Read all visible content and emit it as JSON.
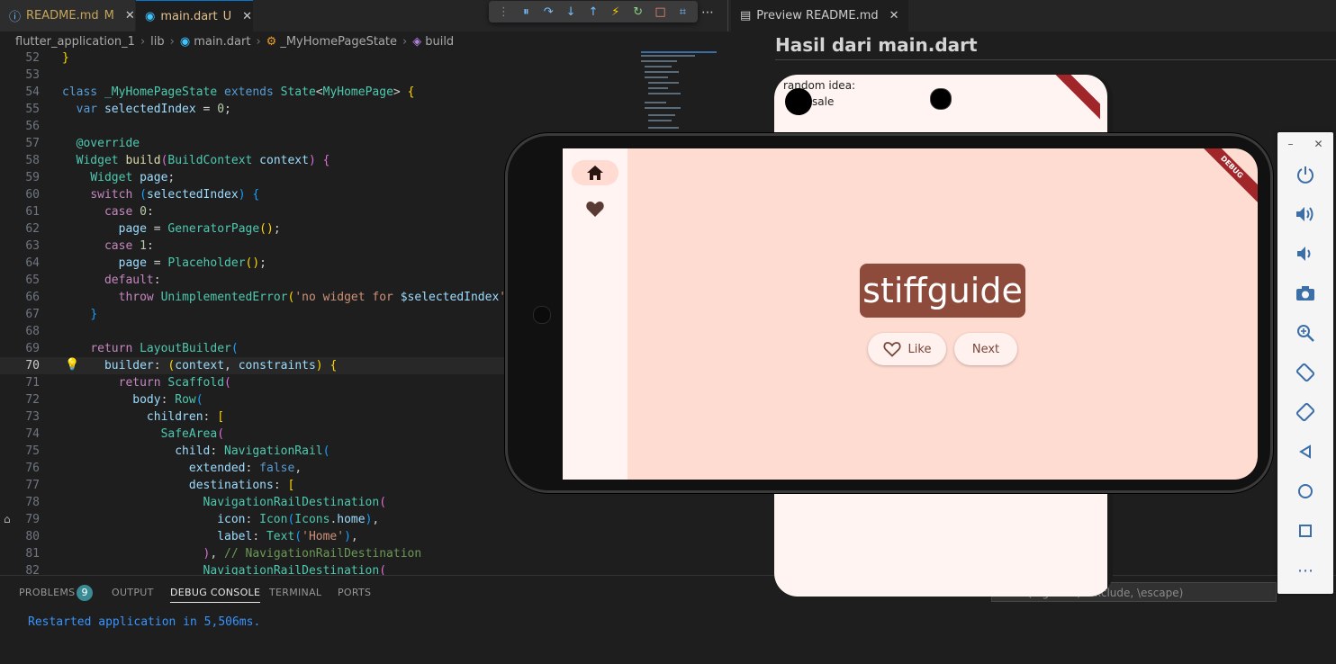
{
  "editor_tabs": [
    {
      "label": "README.md",
      "status": "M",
      "icon": "info-icon"
    },
    {
      "label": "main.dart",
      "status": "U",
      "icon": "dart-icon"
    }
  ],
  "breadcrumb": [
    "flutter_application_1",
    "lib",
    "main.dart",
    "_MyHomePageState",
    "build"
  ],
  "code_lines": [
    {
      "n": "52",
      "html": "<span class='br1'>}</span>"
    },
    {
      "n": "53",
      "html": ""
    },
    {
      "n": "54",
      "html": "<span class='kw'>class</span> <span class='cl'>_MyHomePageState</span> <span class='kw'>extends</span> <span class='cl'>State</span>&lt;<span class='cl'>MyHomePage</span>&gt; <span class='br1'>{</span>"
    },
    {
      "n": "55",
      "html": "  <span class='kw'>var</span> <span class='vr'>selectedIndex</span> = <span class='num'>0</span>;"
    },
    {
      "n": "56",
      "html": ""
    },
    {
      "n": "57",
      "html": "  <span class='cl'>@override</span>"
    },
    {
      "n": "58",
      "html": "  <span class='cl'>Widget</span> <span class='fn'>build</span><span class='br2'>(</span><span class='cl'>BuildContext</span> <span class='vr'>context</span><span class='br2'>)</span> <span class='br2'>{</span>"
    },
    {
      "n": "59",
      "html": "    <span class='cl'>Widget</span> <span class='vr'>page</span>;"
    },
    {
      "n": "60",
      "html": "    <span class='ctl'>switch</span> <span class='br3'>(</span><span class='vr'>selectedIndex</span><span class='br3'>)</span> <span class='br3'>{</span>"
    },
    {
      "n": "61",
      "html": "      <span class='ctl'>case</span> <span class='num'>0</span>:"
    },
    {
      "n": "62",
      "html": "        <span class='vr'>page</span> = <span class='cl'>GeneratorPage</span><span class='br1'>()</span>;"
    },
    {
      "n": "63",
      "html": "      <span class='ctl'>case</span> <span class='num'>1</span>:"
    },
    {
      "n": "64",
      "html": "        <span class='vr'>page</span> = <span class='cl'>Placeholder</span><span class='br1'>()</span>;"
    },
    {
      "n": "65",
      "html": "      <span class='ctl'>default</span>:"
    },
    {
      "n": "66",
      "html": "        <span class='ctl'>throw</span> <span class='cl'>UnimplementedError</span><span class='br1'>(</span><span class='str'>'no widget for </span><span class='vr'>$selectedIndex</span><span class='str'>'</span><span class='br1'>)</span>;"
    },
    {
      "n": "67",
      "html": "    <span class='br3'>}</span>"
    },
    {
      "n": "68",
      "html": ""
    },
    {
      "n": "69",
      "html": "    <span class='ctl'>return</span> <span class='cl'>LayoutBuilder</span><span class='br3'>(</span>"
    },
    {
      "n": "70",
      "html": "      <span class='vr'>builder</span>: <span class='br1'>(</span><span class='vr'>context</span>, <span class='vr'>constraints</span><span class='br1'>)</span> <span class='br1'>{</span>"
    },
    {
      "n": "71",
      "html": "        <span class='ctl'>return</span> <span class='cl'>Scaffold</span><span class='br2'>(</span>"
    },
    {
      "n": "72",
      "html": "          <span class='vr'>body</span>: <span class='cl'>Row</span><span class='br3'>(</span>"
    },
    {
      "n": "73",
      "html": "            <span class='vr'>children</span>: <span class='br1'>[</span>"
    },
    {
      "n": "74",
      "html": "              <span class='cl'>SafeArea</span><span class='br2'>(</span>"
    },
    {
      "n": "75",
      "html": "                <span class='vr'>child</span>: <span class='cl'>NavigationRail</span><span class='br3'>(</span>"
    },
    {
      "n": "76",
      "html": "                  <span class='vr'>extended</span>: <span class='kw'>false</span>,"
    },
    {
      "n": "77",
      "html": "                  <span class='vr'>destinations</span>: <span class='br1'>[</span>"
    },
    {
      "n": "78",
      "html": "                    <span class='cl'>NavigationRailDestination</span><span class='br2'>(</span>"
    },
    {
      "n": "79",
      "html": "                      <span class='vr'>icon</span>: <span class='cl'>Icon</span><span class='br3'>(</span><span class='cl'>Icons</span>.<span class='vr'>home</span><span class='br3'>)</span>,"
    },
    {
      "n": "80",
      "html": "                      <span class='vr'>label</span>: <span class='cl'>Text</span><span class='br3'>(</span><span class='str'>'Home'</span><span class='br3'>)</span>,"
    },
    {
      "n": "81",
      "html": "                    <span class='br2'>)</span>, <span class='cm'>// NavigationRailDestination</span>"
    },
    {
      "n": "82",
      "html": "                    <span class='cl'>NavigationRailDestination</span><span class='br2'>(</span>"
    }
  ],
  "current_line": "70",
  "panel": {
    "tabs": [
      "PROBLEMS",
      "OUTPUT",
      "DEBUG CONSOLE",
      "TERMINAL",
      "PORTS"
    ],
    "problems_count": "9",
    "active_tab": "DEBUG CONSOLE",
    "console_text": "Restarted application in 5,506ms.",
    "filter_placeholder": "Filter (e.g. text, !exclude, \\escape)"
  },
  "preview": {
    "tab_label": "Preview README.md",
    "title": "Hasil dari main.dart",
    "portrait_text_1": "random idea:",
    "portrait_text_2": "sale"
  },
  "app": {
    "word": "stiffguide",
    "like_label": "Like",
    "next_label": "Next",
    "debug_banner": "DEBUG",
    "rail_color": "#fff4f1",
    "background": "#ffdcd2",
    "card_color": "#8e4a3b"
  }
}
